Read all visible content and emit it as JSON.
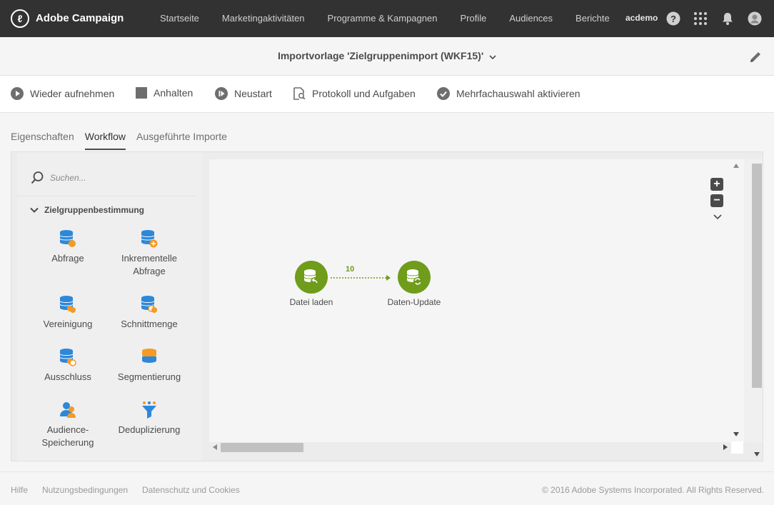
{
  "header": {
    "brand": "Adobe Campaign",
    "nav": [
      "Startseite",
      "Marketingaktivitäten",
      "Programme & Kampagnen",
      "Profile",
      "Audiences",
      "Berichte"
    ],
    "user": "acdemo"
  },
  "title": "Importvorlage 'Zielgruppenimport (WKF15)'",
  "toolbar": {
    "resume": "Wieder aufnehmen",
    "stop": "Anhalten",
    "restart": "Neustart",
    "log": "Protokoll und Aufgaben",
    "multiselect": "Mehrfachauswahl aktivieren"
  },
  "tabs": [
    "Eigenschaften",
    "Workflow",
    "Ausgeführte Importe"
  ],
  "palette": {
    "search_placeholder": "Suchen...",
    "section": "Zielgruppenbestimmung",
    "activities": [
      "Abfrage",
      "Inkrementelle Abfrage",
      "Vereinigung",
      "Schnittmenge",
      "Ausschluss",
      "Segmentierung",
      "Audience-Speicherung",
      "Deduplizierung"
    ]
  },
  "workflow": {
    "nodes": [
      "Datei laden",
      "Daten-Update"
    ],
    "transition_count": "10"
  },
  "footer": {
    "links": [
      "Hilfe",
      "Nutzungsbedingungen",
      "Datenschutz und Cookies"
    ],
    "copyright": "© 2016 Adobe Systems Incorporated. All Rights Reserved."
  },
  "colors": {
    "topbar": "#323232",
    "accent_green": "#6f9c1b",
    "activity_blue": "#2d88d9",
    "activity_orange": "#f59a23"
  }
}
